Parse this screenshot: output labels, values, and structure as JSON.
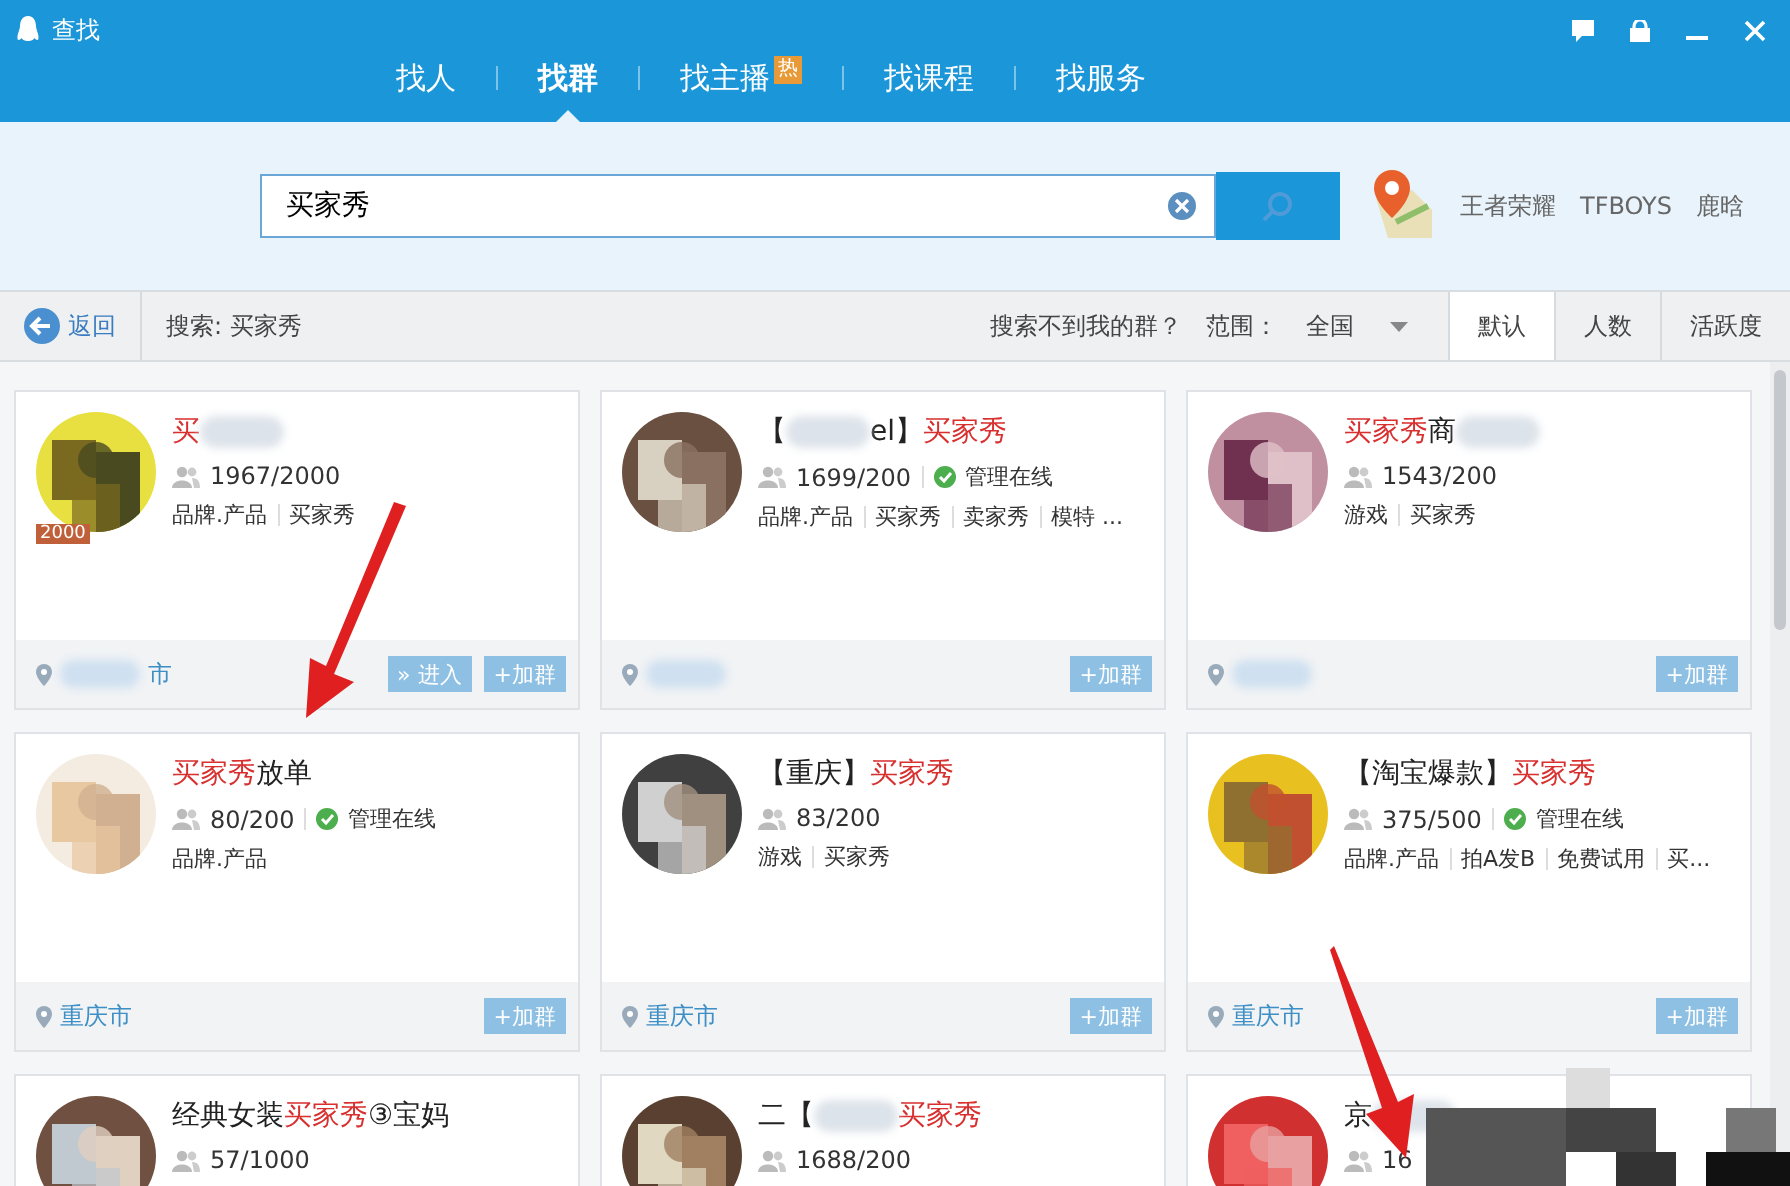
{
  "window": {
    "title": "查找"
  },
  "tabs": [
    {
      "label": "找人",
      "selected": false
    },
    {
      "label": "找群",
      "selected": true
    },
    {
      "label": "找主播",
      "selected": false,
      "badge": "热"
    },
    {
      "label": "找课程",
      "selected": false
    },
    {
      "label": "找服务",
      "selected": false
    }
  ],
  "search": {
    "value": "买家秀"
  },
  "hot_words": [
    "王者荣耀",
    "TFBOYS",
    "鹿晗"
  ],
  "toolbar": {
    "back": "返回",
    "query": "搜索: 买家秀",
    "help": "搜索不到我的群？",
    "range_label": "范围：",
    "range_value": "全国",
    "sort": [
      {
        "label": "默认",
        "selected": true
      },
      {
        "label": "人数",
        "selected": false
      },
      {
        "label": "活跃度",
        "selected": false
      }
    ]
  },
  "groups": [
    {
      "title": [
        {
          "text": "买",
          "highlight": true
        },
        {
          "kind": "redacted"
        }
      ],
      "badge": "2000",
      "members": "1967/2000",
      "admin_online": false,
      "tags": [
        "品牌.产品",
        "买家秀"
      ],
      "location": [
        {
          "kind": "redacted"
        },
        {
          "text": "市"
        }
      ],
      "buttons": [
        "» 进入",
        "+加群"
      ]
    },
    {
      "title": [
        {
          "text": "【",
          "highlight": false
        },
        {
          "kind": "redacted"
        },
        {
          "text": "el】",
          "highlight": false
        },
        {
          "text": "买家秀",
          "highlight": true
        }
      ],
      "members": "1699/200",
      "admin_online": true,
      "admin_label": "管理在线",
      "tags": [
        "品牌.产品",
        "买家秀",
        "卖家秀",
        "模特 ..."
      ],
      "location": [
        {
          "kind": "redacted"
        }
      ],
      "buttons": [
        "+加群"
      ]
    },
    {
      "title": [
        {
          "text": "买家秀",
          "highlight": true
        },
        {
          "text": "商",
          "highlight": false
        },
        {
          "kind": "redacted"
        }
      ],
      "members": "1543/200",
      "admin_online": false,
      "tags": [
        "游戏",
        "买家秀"
      ],
      "location": [
        {
          "kind": "redacted"
        }
      ],
      "buttons": [
        "+加群"
      ]
    },
    {
      "title": [
        {
          "text": "买家秀",
          "highlight": true
        },
        {
          "text": "放单",
          "highlight": false
        }
      ],
      "members": "80/200",
      "admin_online": true,
      "admin_label": "管理在线",
      "tags": [
        "品牌.产品"
      ],
      "location": [
        {
          "text": "重庆市"
        }
      ],
      "buttons": [
        "+加群"
      ]
    },
    {
      "title": [
        {
          "text": "【重庆】",
          "highlight": false
        },
        {
          "text": "买家秀",
          "highlight": true
        }
      ],
      "members": "83/200",
      "admin_online": false,
      "tags": [
        "游戏",
        "买家秀"
      ],
      "location": [
        {
          "text": "重庆市"
        }
      ],
      "buttons": [
        "+加群"
      ]
    },
    {
      "title": [
        {
          "text": "【淘宝爆款】",
          "highlight": false
        },
        {
          "text": "买家秀",
          "highlight": true
        }
      ],
      "members": "375/500",
      "admin_online": true,
      "admin_label": "管理在线",
      "tags": [
        "品牌.产品",
        "拍A发B",
        "免费试用",
        "买..."
      ],
      "location": [
        {
          "text": "重庆市"
        }
      ],
      "buttons": [
        "+加群"
      ]
    },
    {
      "title": [
        {
          "text": "经典女装",
          "highlight": false
        },
        {
          "text": "买家秀",
          "highlight": true
        },
        {
          "text": "③宝妈",
          "highlight": false
        }
      ],
      "members": "57/1000",
      "admin_online": false
    },
    {
      "title": [
        {
          "text": "二【",
          "highlight": false
        },
        {
          "kind": "redacted"
        },
        {
          "text": "买家秀",
          "highlight": true
        }
      ],
      "members": "1688/200",
      "admin_online": false
    },
    {
      "title": [
        {
          "text": "京",
          "highlight": false
        },
        {
          "kind": "redacted"
        }
      ],
      "members": "16",
      "admin_online": false
    }
  ]
}
